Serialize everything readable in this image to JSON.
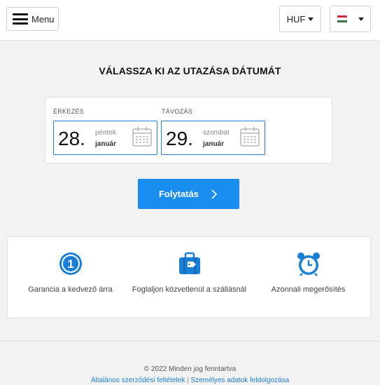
{
  "header": {
    "menu_label": "Menu",
    "currency": "HUF",
    "language_flag": "hungary-flag",
    "flag_colors": [
      "#cd2a3e",
      "#ffffff",
      "#436f4d"
    ]
  },
  "page_title": "VÁLASSZA KI AZ UTAZÁSA DÁTUMÁT",
  "arrival": {
    "label": "ÉRKEZÉS",
    "day": "28.",
    "weekday": "péntek",
    "month": "január"
  },
  "departure": {
    "label": "TÁVOZÁS",
    "day": "29.",
    "weekday": "szombat",
    "month": "január"
  },
  "continue_label": "Folytatás",
  "features": [
    {
      "icon": "number-one-badge-icon",
      "text": "Garancia a kedvező árra"
    },
    {
      "icon": "suitcase-tag-icon",
      "text": "Foglaljon közvetlenül a szállásnál"
    },
    {
      "icon": "alarm-clock-icon",
      "text": "Azonnali megerősítés"
    }
  ],
  "footer": {
    "copyright": "© 2022 Minden jog fenntartva",
    "terms_link": "Általános szerződési feltételek",
    "separator": "|",
    "privacy_link": "Személyes adatok feldolgozása"
  },
  "colors": {
    "accent": "#1a8ef0",
    "icon_blue": "#1a7fd6",
    "background": "#f2f2f2"
  }
}
